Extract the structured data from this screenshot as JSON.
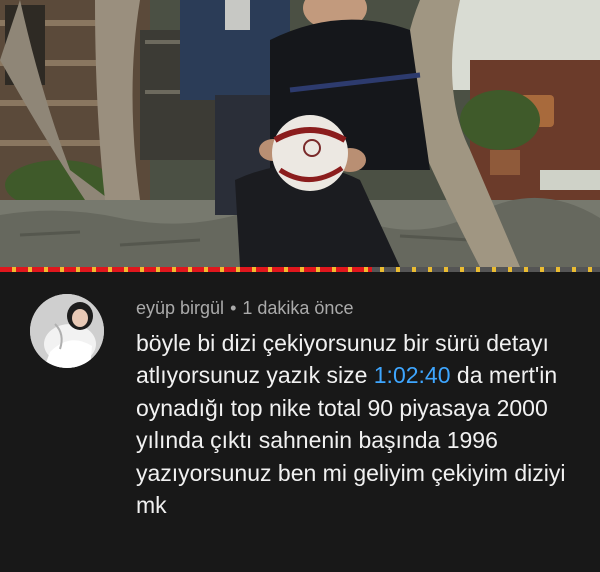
{
  "video": {
    "scene": "video-still"
  },
  "progress": {
    "fraction": 0.62,
    "fill_color": "#e0171d",
    "marker_color": "#f2c230"
  },
  "comment": {
    "author": "eyüp birgül",
    "separator": "•",
    "time_ago": "1 dakika önce",
    "text_part1": "böyle bi dizi çekiyorsunuz bir sürü detayı atlıyorsunuz yazık size ",
    "timestamp_link": "1:02:40",
    "text_part2": " da mert'in oynadığı top nike total 90 piyasaya 2000 yılında çıktı sahnenin başında 1996 yazıyorsunuz ben mi geliyim çekiyim diziyi mk",
    "link_color": "#3ea6ff",
    "avatar_icon": "avatar-icon"
  }
}
